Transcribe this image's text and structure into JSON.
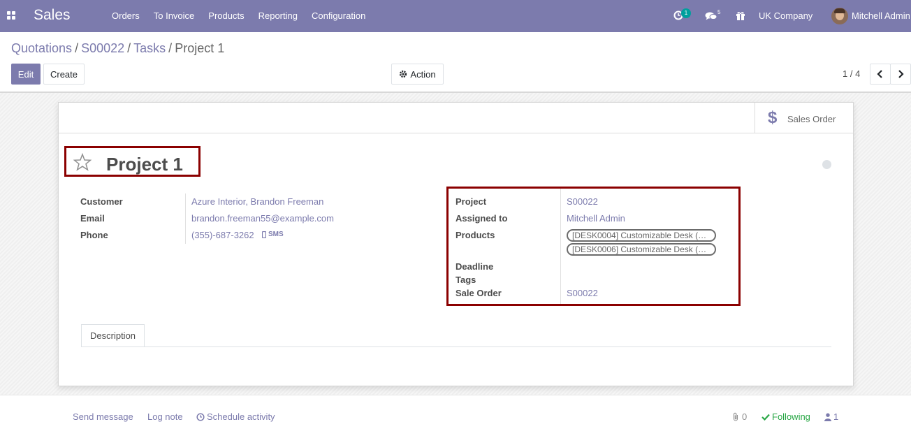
{
  "navbar": {
    "app_name": "Sales",
    "menu": [
      "Orders",
      "To Invoice",
      "Products",
      "Reporting",
      "Configuration"
    ],
    "activity_count": "1",
    "message_count": "5",
    "company": "UK Company",
    "user": "Mitchell Admin",
    "bg_color": "#7c7bad"
  },
  "breadcrumb": {
    "items": [
      "Quotations",
      "S00022",
      "Tasks"
    ],
    "current": "Project 1"
  },
  "toolbar": {
    "edit_label": "Edit",
    "create_label": "Create",
    "action_label": "Action",
    "pager": "1 / 4"
  },
  "smart_button": {
    "label": "Sales Order",
    "icon": "dollar-icon"
  },
  "record": {
    "title": "Project 1",
    "customer_label": "Customer",
    "customer": "Azure Interior, Brandon Freeman",
    "email_label": "Email",
    "email": "brandon.freeman55@example.com",
    "phone_label": "Phone",
    "phone": "(355)-687-3262",
    "sms_label": "SMS",
    "project_label": "Project",
    "project": "S00022",
    "assigned_label": "Assigned to",
    "assigned": "Mitchell Admin",
    "products_label": "Products",
    "products": [
      "[DESK0004] Customizable Desk (…",
      "[DESK0006] Customizable Desk (…"
    ],
    "deadline_label": "Deadline",
    "tags_label": "Tags",
    "sale_order_label": "Sale Order",
    "sale_order": "S00022"
  },
  "tabs": {
    "description": "Description"
  },
  "chatter": {
    "send_message": "Send message",
    "log_note": "Log note",
    "schedule_activity": "Schedule activity",
    "attachments": "0",
    "following": "Following",
    "followers": "1"
  }
}
